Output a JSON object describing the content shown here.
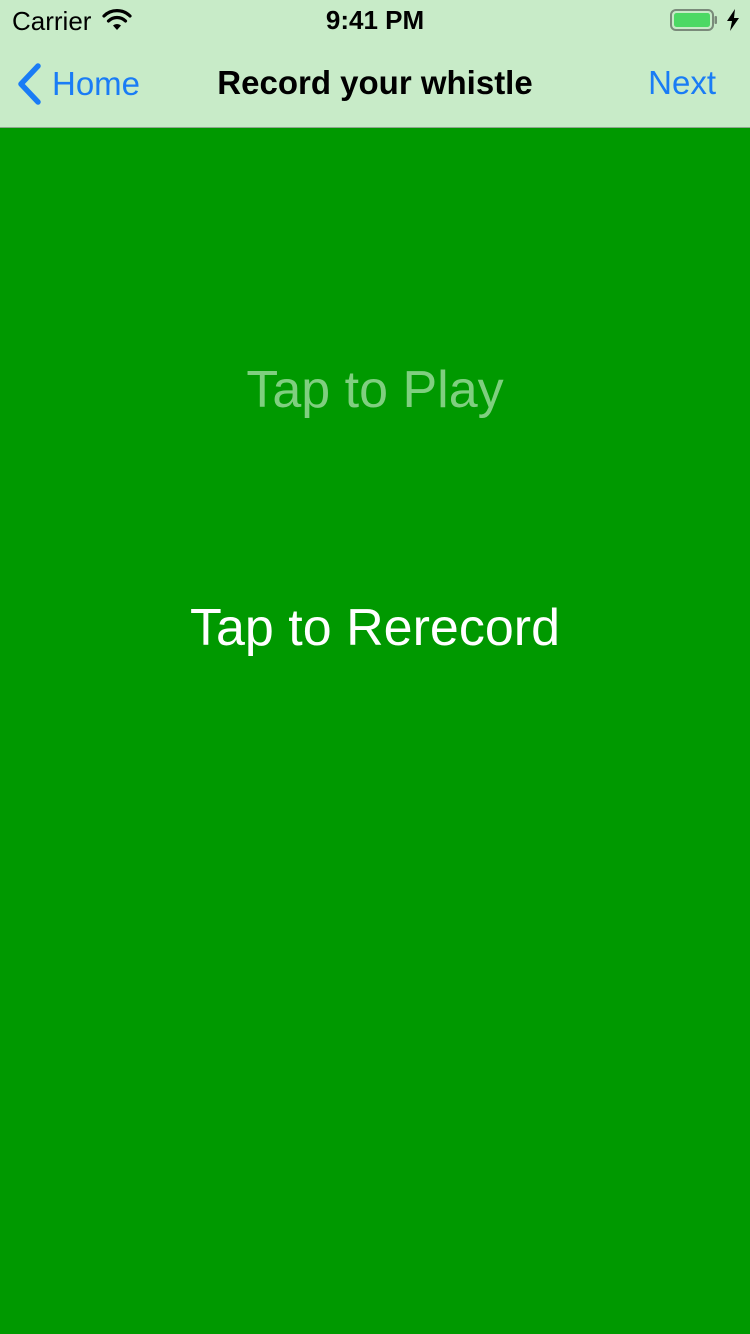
{
  "status_bar": {
    "carrier": "Carrier",
    "time": "9:41 PM",
    "wifi_icon": "wifi-icon",
    "battery_icon": "battery-full-icon",
    "charging_icon": "charging-bolt-icon",
    "battery_color": "#4cd964"
  },
  "nav": {
    "back_label": "Home",
    "back_icon": "chevron-left-icon",
    "title": "Record your whistle",
    "next_label": "Next",
    "tint_color": "#1a7cf5",
    "background": "#c8ebc8"
  },
  "main": {
    "background": "#009900",
    "play_label": "Tap to Play",
    "rerecord_label": "Tap to Rerecord"
  }
}
